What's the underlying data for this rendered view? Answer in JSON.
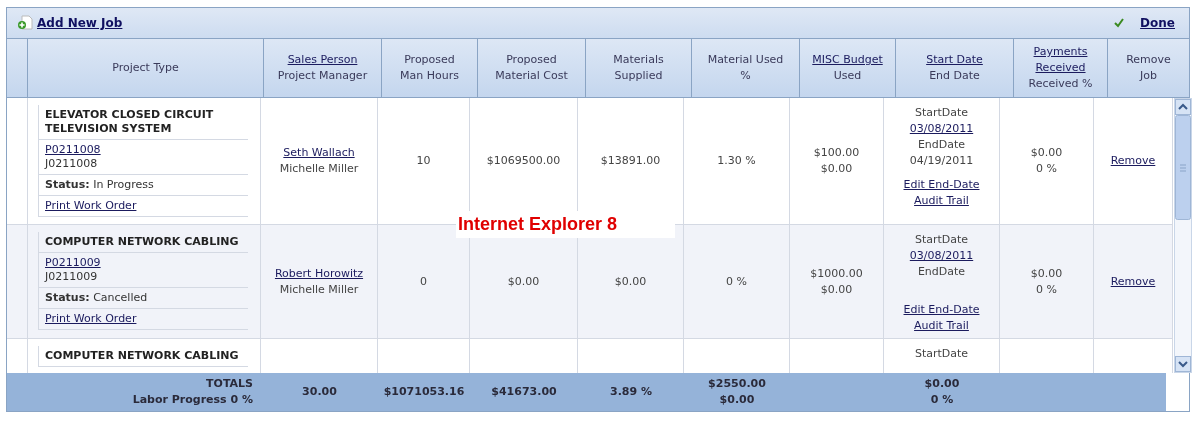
{
  "toolbar": {
    "add_link": "Add New Job",
    "done_link": "Done"
  },
  "columns": [
    {},
    {
      "lines": [
        {
          "text": "Project Type",
          "link": false
        }
      ]
    },
    {
      "lines": [
        {
          "text": "Sales Person",
          "link": true
        },
        {
          "text": "Project Manager",
          "link": false
        }
      ]
    },
    {
      "lines": [
        {
          "text": "Proposed",
          "link": false
        },
        {
          "text": "Man Hours",
          "link": false
        }
      ]
    },
    {
      "lines": [
        {
          "text": "Proposed",
          "link": false
        },
        {
          "text": "Material Cost",
          "link": false
        }
      ]
    },
    {
      "lines": [
        {
          "text": "Materials",
          "link": false
        },
        {
          "text": "Supplied",
          "link": false
        }
      ]
    },
    {
      "lines": [
        {
          "text": "Material Used",
          "link": false
        },
        {
          "text": "%",
          "link": false
        }
      ]
    },
    {
      "lines": [
        {
          "text": "MISC Budget",
          "link": true
        },
        {
          "text": "Used",
          "link": false
        }
      ]
    },
    {
      "lines": [
        {
          "text": "Start Date",
          "link": true
        },
        {
          "text": "End Date",
          "link": false
        }
      ]
    },
    {
      "lines": [
        {
          "text": "Payments",
          "link": true
        },
        {
          "text": "Received",
          "link": true
        },
        {
          "text": "Received %",
          "link": false
        }
      ]
    },
    {
      "lines": [
        {
          "text": "Remove",
          "link": false
        },
        {
          "text": "Job",
          "link": false
        }
      ]
    }
  ],
  "rows": [
    {
      "title": "ELEVATOR CLOSED CIRCUIT TELEVISION SYSTEM",
      "po": "P0211008",
      "job": "J0211008",
      "status": "**Status:** In Progress",
      "print_link": "Print Work Order",
      "sales_person": "Seth Wallach",
      "manager": "Michelle Miller",
      "hours": "10",
      "material_cost": "$1069500.00",
      "materials_supplied": "$13891.00",
      "material_used": "1.30 %",
      "misc_budget": "$100.00",
      "misc_used": "$0.00",
      "start_label": "StartDate",
      "start_date": "03/08/2011",
      "end_label": "EndDate",
      "end_date": "04/19/2011",
      "edit_link": "Edit End-Date",
      "audit_link": "Audit Trail",
      "payments": "$0.00",
      "received_pct": "0 %",
      "remove": "Remove"
    },
    {
      "title": "COMPUTER NETWORK CABLING",
      "po": "P0211009",
      "job": "J0211009",
      "status": "**Status:** Cancelled",
      "print_link": "Print Work Order",
      "sales_person": "Robert Horowitz",
      "manager": "Michelle Miller",
      "hours": "0",
      "material_cost": "$0.00",
      "materials_supplied": "$0.00",
      "material_used": "0 %",
      "misc_budget": "$1000.00",
      "misc_used": "$0.00",
      "start_label": "StartDate",
      "start_date": "03/08/2011",
      "end_label": "EndDate",
      "edit_link": "Edit End-Date",
      "audit_link": "Audit Trail",
      "payments": "$0.00",
      "received_pct": "0 %",
      "remove": "Remove"
    },
    {
      "title": "COMPUTER NETWORK CABLING",
      "start_label": "StartDate"
    }
  ],
  "totals": {
    "label": "TOTALS",
    "labor_progress": "Labor Progress 0 %",
    "hours": "30.00",
    "material_cost": "$1071053.16",
    "materials_supplied": "$41673.00",
    "material_used": "3.89 %",
    "misc_budget": "$2550.00",
    "misc_used": "$0.00",
    "payments": "$0.00",
    "received_pct": "0 %"
  },
  "annotation": "Internet Explorer 8"
}
